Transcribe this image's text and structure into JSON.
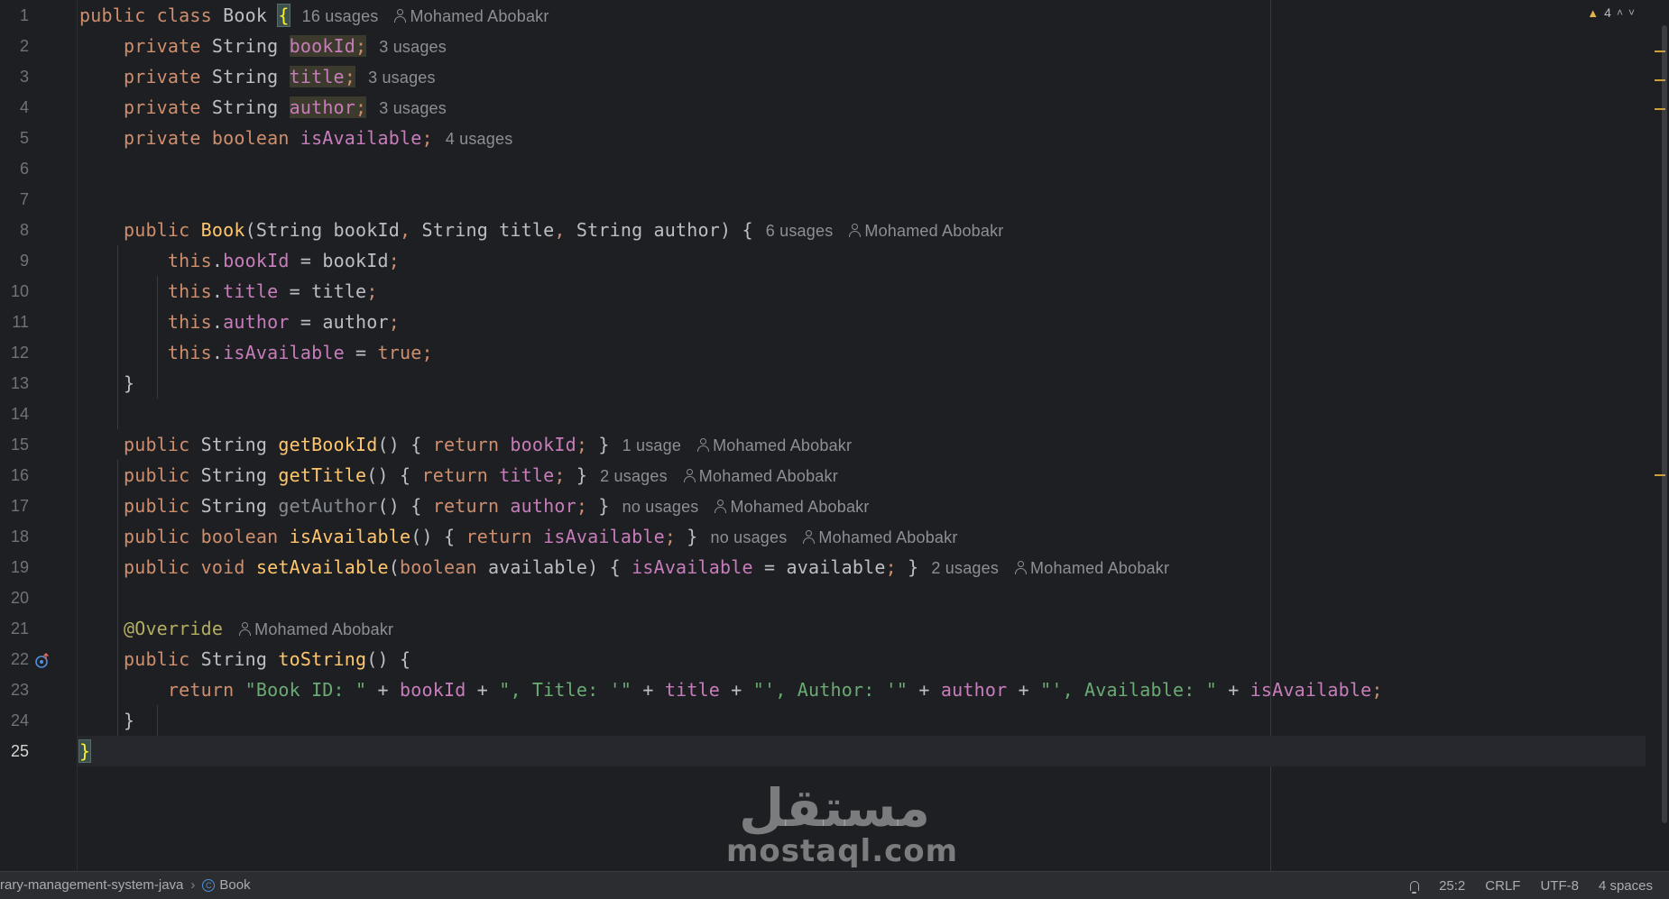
{
  "editor": {
    "lines": [
      {
        "n": "1",
        "tokens": [
          {
            "t": "public class ",
            "c": "kw"
          },
          {
            "t": "Book ",
            "c": "cls"
          },
          {
            "t": "{",
            "c": "brace-match"
          }
        ],
        "hint": "16 usages",
        "author": "Mohamed Abobakr"
      },
      {
        "n": "2",
        "tokens": [
          {
            "t": "    private ",
            "c": "kw"
          },
          {
            "t": "String ",
            "c": "cls"
          },
          {
            "t": "bookId",
            "c": "fld hl-occ"
          },
          {
            "t": ";",
            "c": "semi hl-occ"
          }
        ],
        "hint": "3 usages"
      },
      {
        "n": "3",
        "tokens": [
          {
            "t": "    private ",
            "c": "kw"
          },
          {
            "t": "String ",
            "c": "cls"
          },
          {
            "t": "title",
            "c": "fld hl-occ"
          },
          {
            "t": ";",
            "c": "semi hl-occ"
          }
        ],
        "hint": "3 usages"
      },
      {
        "n": "4",
        "tokens": [
          {
            "t": "    private ",
            "c": "kw"
          },
          {
            "t": "String ",
            "c": "cls"
          },
          {
            "t": "author",
            "c": "fld hl-occ"
          },
          {
            "t": ";",
            "c": "semi hl-occ"
          }
        ],
        "hint": "3 usages"
      },
      {
        "n": "5",
        "tokens": [
          {
            "t": "    private boolean ",
            "c": "kw"
          },
          {
            "t": "isAvailable",
            "c": "fld"
          },
          {
            "t": ";",
            "c": "semi"
          }
        ],
        "hint": "4 usages"
      },
      {
        "n": "6",
        "tokens": []
      },
      {
        "n": "7",
        "tokens": []
      },
      {
        "n": "8",
        "tokens": [
          {
            "t": "    public ",
            "c": "kw"
          },
          {
            "t": "Book",
            "c": "fnn"
          },
          {
            "t": "(String bookId",
            "c": "punct"
          },
          {
            "t": ", ",
            "c": "semi"
          },
          {
            "t": "String title",
            "c": "punct"
          },
          {
            "t": ", ",
            "c": "semi"
          },
          {
            "t": "String author) {",
            "c": "punct"
          }
        ],
        "hint": "6 usages",
        "author": "Mohamed Abobakr"
      },
      {
        "n": "9",
        "tokens": [
          {
            "t": "        this",
            "c": "kw"
          },
          {
            "t": ".",
            "c": "punct"
          },
          {
            "t": "bookId",
            "c": "fld"
          },
          {
            "t": " = bookId",
            "c": "punct"
          },
          {
            "t": ";",
            "c": "semi"
          }
        ]
      },
      {
        "n": "10",
        "tokens": [
          {
            "t": "        this",
            "c": "kw"
          },
          {
            "t": ".",
            "c": "punct"
          },
          {
            "t": "title",
            "c": "fld"
          },
          {
            "t": " = title",
            "c": "punct"
          },
          {
            "t": ";",
            "c": "semi"
          }
        ]
      },
      {
        "n": "11",
        "tokens": [
          {
            "t": "        this",
            "c": "kw"
          },
          {
            "t": ".",
            "c": "punct"
          },
          {
            "t": "author",
            "c": "fld"
          },
          {
            "t": " = author",
            "c": "punct"
          },
          {
            "t": ";",
            "c": "semi"
          }
        ]
      },
      {
        "n": "12",
        "tokens": [
          {
            "t": "        this",
            "c": "kw"
          },
          {
            "t": ".",
            "c": "punct"
          },
          {
            "t": "isAvailable",
            "c": "fld"
          },
          {
            "t": " = ",
            "c": "punct"
          },
          {
            "t": "true",
            "c": "kw"
          },
          {
            "t": ";",
            "c": "semi"
          }
        ]
      },
      {
        "n": "13",
        "tokens": [
          {
            "t": "    }",
            "c": "punct"
          }
        ]
      },
      {
        "n": "14",
        "tokens": []
      },
      {
        "n": "15",
        "tokens": [
          {
            "t": "    public ",
            "c": "kw"
          },
          {
            "t": "String ",
            "c": "cls"
          },
          {
            "t": "getBookId",
            "c": "fnn"
          },
          {
            "t": "() { ",
            "c": "punct"
          },
          {
            "t": "return ",
            "c": "kw"
          },
          {
            "t": "bookId",
            "c": "fld"
          },
          {
            "t": "; ",
            "c": "semi"
          },
          {
            "t": "}",
            "c": "punct"
          }
        ],
        "hint": "1 usage",
        "author": "Mohamed Abobakr"
      },
      {
        "n": "16",
        "tokens": [
          {
            "t": "    public ",
            "c": "kw"
          },
          {
            "t": "String ",
            "c": "cls"
          },
          {
            "t": "getTitle",
            "c": "fnn"
          },
          {
            "t": "() { ",
            "c": "punct"
          },
          {
            "t": "return ",
            "c": "kw"
          },
          {
            "t": "title",
            "c": "fld"
          },
          {
            "t": "; ",
            "c": "semi"
          },
          {
            "t": "}",
            "c": "punct"
          }
        ],
        "hint": "2 usages",
        "author": "Mohamed Abobakr"
      },
      {
        "n": "17",
        "tokens": [
          {
            "t": "    public ",
            "c": "kw"
          },
          {
            "t": "String ",
            "c": "cls"
          },
          {
            "t": "getAuthor",
            "c": "unused"
          },
          {
            "t": "() { ",
            "c": "punct"
          },
          {
            "t": "return ",
            "c": "kw"
          },
          {
            "t": "author",
            "c": "fld"
          },
          {
            "t": "; ",
            "c": "semi"
          },
          {
            "t": "}",
            "c": "punct"
          }
        ],
        "hint": "no usages",
        "author": "Mohamed Abobakr"
      },
      {
        "n": "18",
        "tokens": [
          {
            "t": "    public boolean ",
            "c": "kw"
          },
          {
            "t": "isAvailable",
            "c": "fnn"
          },
          {
            "t": "() { ",
            "c": "punct"
          },
          {
            "t": "return ",
            "c": "kw"
          },
          {
            "t": "isAvailable",
            "c": "fld"
          },
          {
            "t": "; ",
            "c": "semi"
          },
          {
            "t": "}",
            "c": "punct"
          }
        ],
        "hint": "no usages",
        "author": "Mohamed Abobakr"
      },
      {
        "n": "19",
        "tokens": [
          {
            "t": "    public void ",
            "c": "kw"
          },
          {
            "t": "setAvailable",
            "c": "fnn"
          },
          {
            "t": "(",
            "c": "punct"
          },
          {
            "t": "boolean ",
            "c": "kw"
          },
          {
            "t": "available) { ",
            "c": "punct"
          },
          {
            "t": "isAvailable",
            "c": "fld"
          },
          {
            "t": " = available",
            "c": "punct"
          },
          {
            "t": "; ",
            "c": "semi"
          },
          {
            "t": "}",
            "c": "punct"
          }
        ],
        "hint": "2 usages",
        "author": "Mohamed Abobakr"
      },
      {
        "n": "20",
        "tokens": []
      },
      {
        "n": "21",
        "tokens": [
          {
            "t": "    @Override",
            "c": "ann"
          }
        ],
        "author": "Mohamed Abobakr"
      },
      {
        "n": "22",
        "tokens": [
          {
            "t": "    public ",
            "c": "kw"
          },
          {
            "t": "String ",
            "c": "cls"
          },
          {
            "t": "toString",
            "c": "fnn"
          },
          {
            "t": "() {",
            "c": "punct"
          }
        ]
      },
      {
        "n": "23",
        "tokens": [
          {
            "t": "        return ",
            "c": "kw"
          },
          {
            "t": "\"Book ID: \"",
            "c": "str"
          },
          {
            "t": " + ",
            "c": "punct"
          },
          {
            "t": "bookId",
            "c": "fld"
          },
          {
            "t": " + ",
            "c": "punct"
          },
          {
            "t": "\", Title: '\"",
            "c": "str"
          },
          {
            "t": " + ",
            "c": "punct"
          },
          {
            "t": "title",
            "c": "fld"
          },
          {
            "t": " + ",
            "c": "punct"
          },
          {
            "t": "\"', Author: '\"",
            "c": "str"
          },
          {
            "t": " + ",
            "c": "punct"
          },
          {
            "t": "author",
            "c": "fld"
          },
          {
            "t": " + ",
            "c": "punct"
          },
          {
            "t": "\"', Available: \"",
            "c": "str"
          },
          {
            "t": " + ",
            "c": "punct"
          },
          {
            "t": "isAvailable",
            "c": "fld"
          },
          {
            "t": ";",
            "c": "semi"
          }
        ]
      },
      {
        "n": "24",
        "tokens": [
          {
            "t": "    }",
            "c": "punct"
          }
        ]
      },
      {
        "n": "25",
        "tokens": [
          {
            "t": "}",
            "c": "brace-match"
          }
        ],
        "current": true
      }
    ]
  },
  "inspection": {
    "warnings": "4"
  },
  "statusbar": {
    "project": "rary-management-system-java",
    "file": "Book",
    "position": "25:2",
    "line_ending": "CRLF",
    "encoding": "UTF-8",
    "indent": "4 spaces"
  },
  "watermark": {
    "arabic": "مستقل",
    "latin": "mostaql.com"
  },
  "colors": {
    "background": "#1e1f22",
    "keyword": "#cf8e6d",
    "field": "#c77dbb",
    "method": "#ffc66d",
    "string": "#6aab73",
    "annotation": "#b3ae60"
  }
}
